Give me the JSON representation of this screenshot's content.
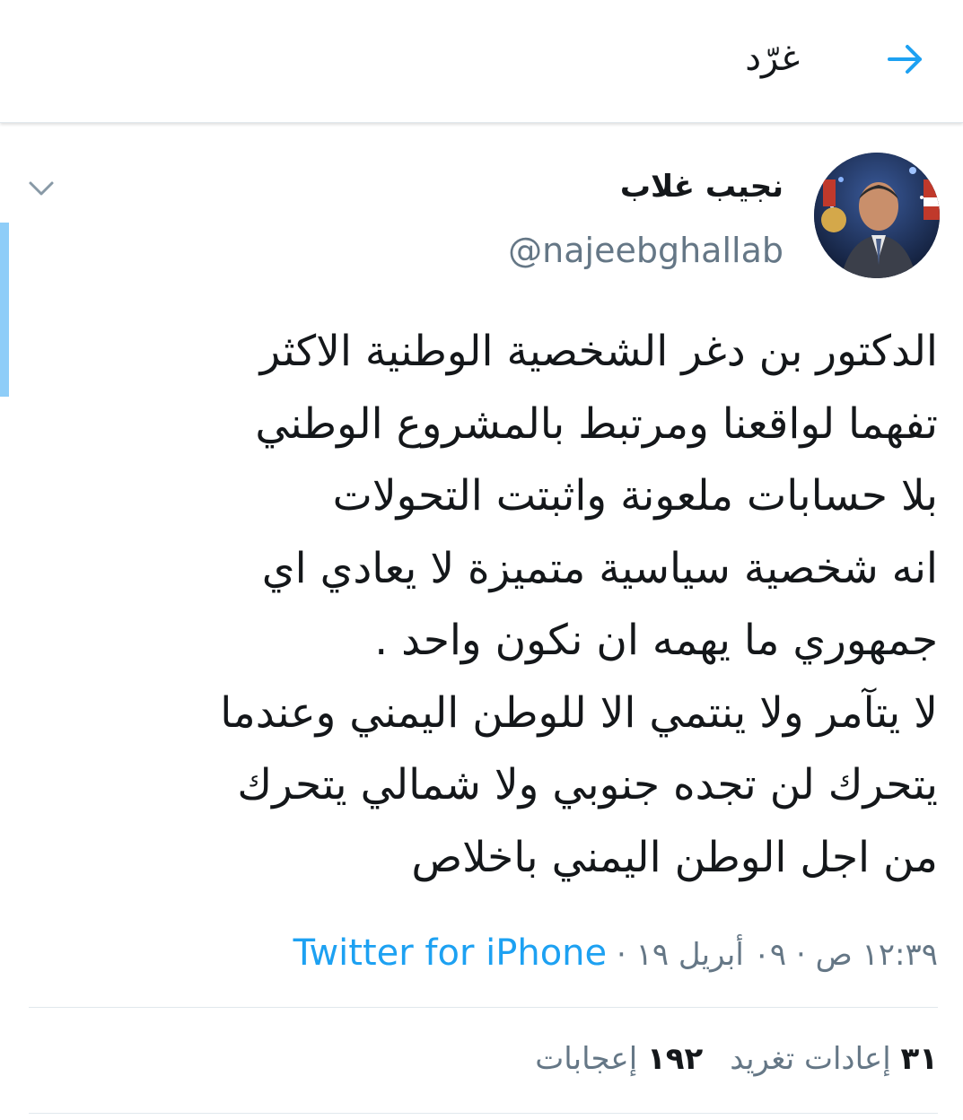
{
  "header": {
    "title": "غرّد",
    "back_icon": "arrow-right-icon"
  },
  "tweet": {
    "display_name": "نجيب غلاب",
    "handle": "@najeebghallab",
    "text_lines": [
      "الدكتور بن دغر الشخصية الوطنية الاكثر",
      "تفهما لواقعنا ومرتبط بالمشروع الوطني",
      "بلا حسابات ملعونة واثبتت التحولات",
      "انه شخصية سياسية متميزة لا يعادي اي",
      "جمهوري ما يهمه ان نكون واحد .",
      "لا يتآمر ولا ينتمي الا للوطن اليمني وعندما",
      "يتحرك لن تجده جنوبي ولا شمالي يتحرك",
      "من اجل الوطن اليمني باخلاص"
    ],
    "timestamp": "١٢:٣٩ ص · ٠٩ أبريل ١٩ · ",
    "source": "Twitter for iPhone",
    "stats": {
      "retweets_count": "٣١",
      "retweets_label": "إعادات تغريد",
      "likes_count": "١٩٢",
      "likes_label": "إعجابات"
    }
  },
  "colors": {
    "accent": "#1da1f2",
    "secondary_text": "#657786",
    "primary_text": "#14171a",
    "divider": "#e1e8ed"
  }
}
